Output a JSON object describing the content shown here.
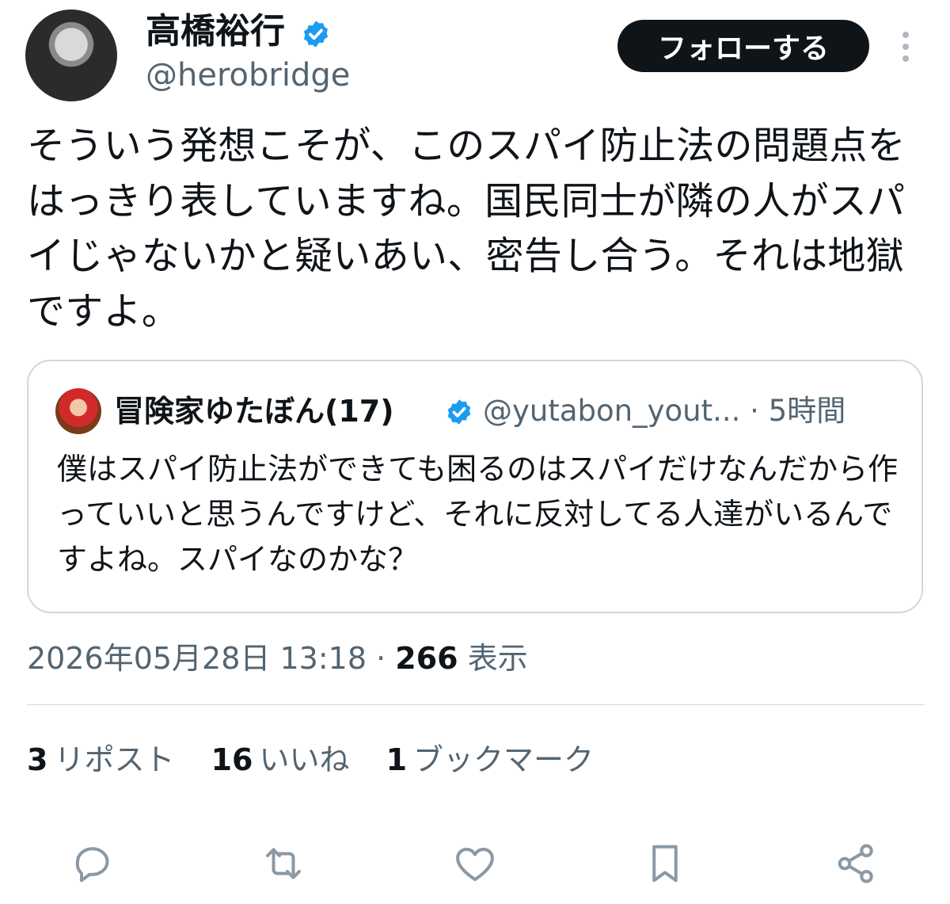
{
  "tweet": {
    "author": {
      "name": "高橋裕行",
      "handle": "@herobridge",
      "verified_icon": "verified-badge-icon"
    },
    "follow_label": "フォローする",
    "more_icon": "more-vertical-icon",
    "text": "そういう発想こそが、このスパイ防止法の問題点をはっきり表していますね。国民同士が隣の人がスパイじゃないかと疑いあい、密告し合う。それは地獄ですよ。",
    "quoted": {
      "name": "冒険家ゆたぼん(17)",
      "handle": "@yutabon_yout...",
      "time": "· 5時間",
      "text": "僕はスパイ防止法ができても困るのはスパイだけなんだから作っていいと思うんですけど、それに反対してる人達がいるんですよね。スパイなのかな？"
    },
    "timestamp": "2026年05月28日 13:18",
    "separator": "·",
    "views_count": "266",
    "views_label": "表示",
    "stats": [
      {
        "count": "3",
        "label": "リポスト"
      },
      {
        "count": "16",
        "label": "いいね"
      },
      {
        "count": "1",
        "label": "ブックマーク"
      }
    ],
    "actions": [
      "reply-icon",
      "retweet-icon",
      "like-icon",
      "bookmark-icon",
      "share-icon"
    ]
  },
  "colors": {
    "text_primary": "#0f1419",
    "text_secondary": "#536471",
    "verified": "#1d9bf0",
    "border": "#cfd9de",
    "follow_bg": "#0f1419"
  }
}
